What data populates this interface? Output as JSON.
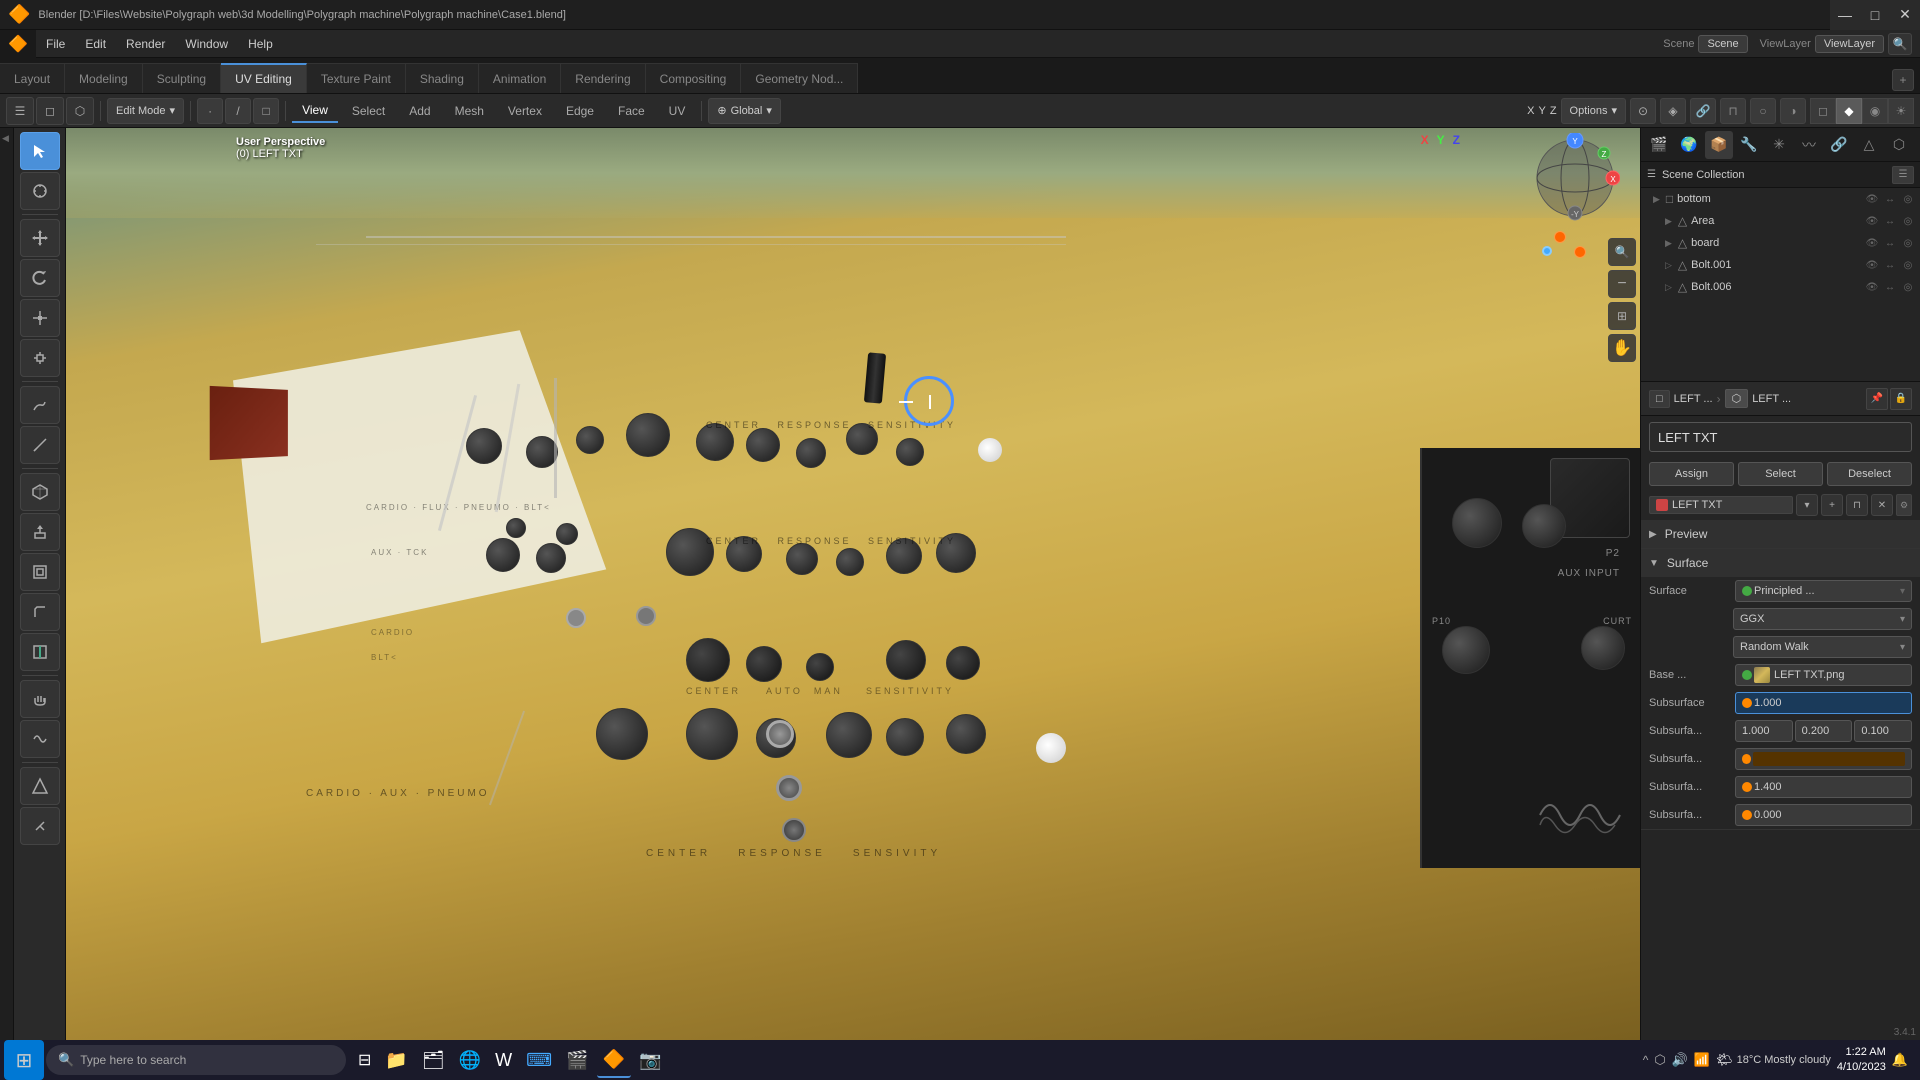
{
  "titlebar": {
    "title": "Blender  [D:\\Files\\Website\\Polygraph web\\3d Modelling\\Polygraph machine\\Polygraph machine\\Case1.blend]",
    "minimize": "—",
    "maximize": "□",
    "close": "✕"
  },
  "menubar": {
    "logo": "🔶",
    "items": [
      "File",
      "Edit",
      "Render",
      "Window",
      "Help"
    ]
  },
  "workspaces": [
    {
      "label": "Layout",
      "active": false
    },
    {
      "label": "Modeling",
      "active": false
    },
    {
      "label": "Sculpting",
      "active": false
    },
    {
      "label": "UV Editing",
      "active": true
    },
    {
      "label": "Texture Paint",
      "active": false
    },
    {
      "label": "Shading",
      "active": false
    },
    {
      "label": "Animation",
      "active": false
    },
    {
      "label": "Rendering",
      "active": false
    },
    {
      "label": "Compositing",
      "active": false
    },
    {
      "label": "Geometry Nod...",
      "active": false
    }
  ],
  "toolbar": {
    "mode_label": "Edit Mode",
    "mode_arrow": "▾",
    "view_btn": "View",
    "select_btn": "Select",
    "add_btn": "Add",
    "mesh_btn": "Mesh",
    "vertex_btn": "Vertex",
    "edge_btn": "Edge",
    "face_btn": "Face",
    "uv_btn": "UV",
    "transform_global": "Global",
    "xyz_x": "X",
    "xyz_y": "Y",
    "xyz_z": "Z",
    "options_btn": "Options"
  },
  "viewport": {
    "mode": "User Perspective",
    "object_info": "(0) LEFT TXT",
    "gizmo_x": "X",
    "gizmo_y": "Y",
    "gizmo_z": "Z"
  },
  "outliner": {
    "title": "Scene Collection",
    "items": [
      {
        "name": "bottom",
        "icon": "▽",
        "visible": true,
        "indent": 0
      },
      {
        "name": "Area",
        "icon": "▽",
        "visible": true,
        "indent": 1
      },
      {
        "name": "board",
        "icon": "▽",
        "visible": true,
        "indent": 1
      },
      {
        "name": "Bolt.001",
        "icon": "▽",
        "visible": true,
        "indent": 1
      },
      {
        "name": "Bolt.006",
        "icon": "▽",
        "visible": true,
        "indent": 1
      }
    ]
  },
  "properties": {
    "breadcrumb1": "LEFT ...",
    "breadcrumb2": "LEFT ...",
    "material_name": "LEFT TXT",
    "assign_btn": "Assign",
    "select_btn": "Select",
    "deselect_btn": "Deselect",
    "mat_active_name": "LEFT TXT",
    "preview_label": "Preview",
    "surface_label": "Surface",
    "surface_type": "Surface",
    "surface_shader": "Principled ...",
    "ggx_label": "GGX",
    "random_walk": "Random Walk",
    "base_label": "Base ...",
    "base_texture": "LEFT TXT.png",
    "subsurface_label": "Subsurface",
    "subsurface_value": "1.000",
    "subsurfa1_label": "Subsurfa...",
    "subsurfa1_val1": "1.000",
    "subsurfa1_val2": "0.200",
    "subsurfa1_val3": "0.100",
    "subsurfa2_label": "Subsurfa...",
    "subsurfa2_color": "#553300",
    "subsurfa3_label": "Subsurfa...",
    "subsurfa3_value": "1.400",
    "subsurfa4_label": "Subsurfa...",
    "subsurfa4_value": "0.000"
  },
  "scene_info": "3.4.1",
  "taskbar": {
    "search_placeholder": "Type here to search",
    "weather": "18°C  Mostly cloudy",
    "time": "1:22 AM",
    "date": "4/10/2023",
    "windows_btn": "⊞"
  }
}
